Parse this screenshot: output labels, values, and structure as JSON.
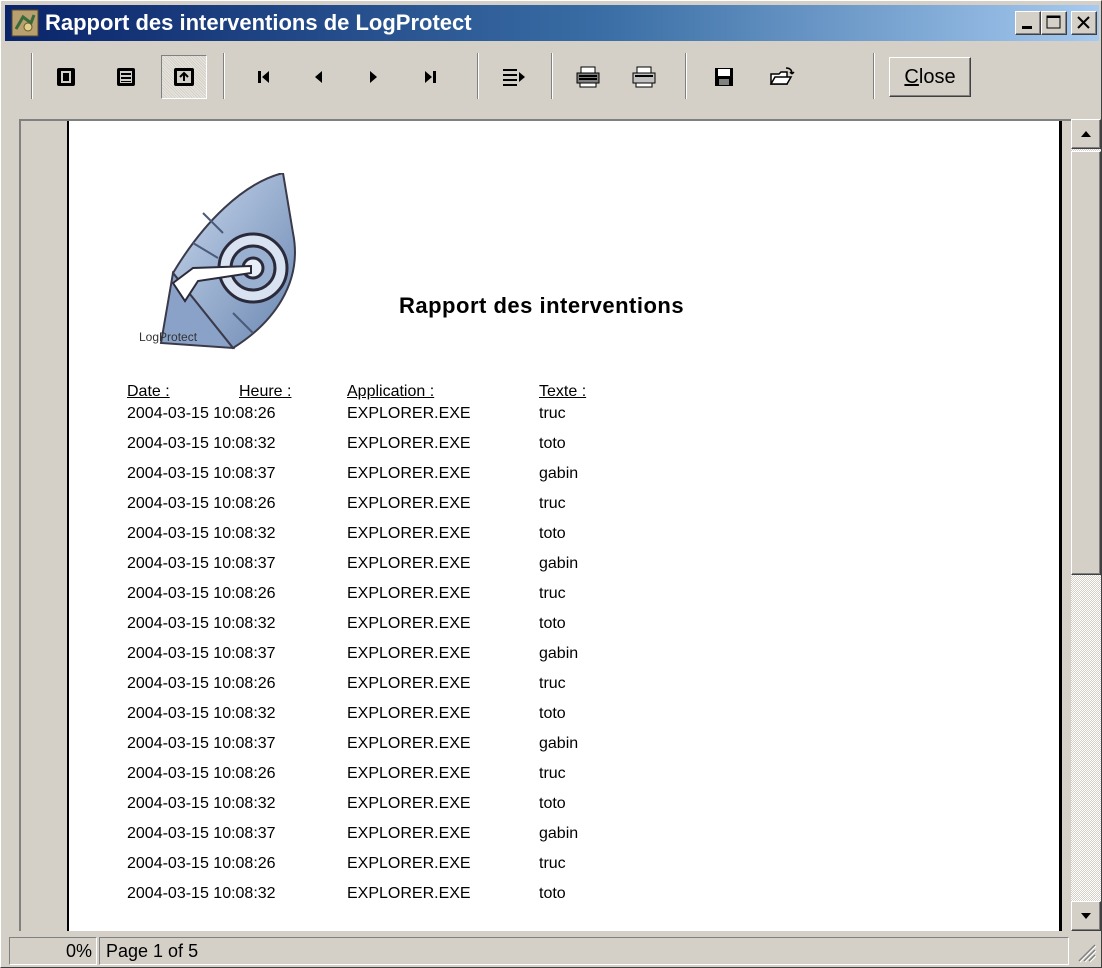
{
  "window": {
    "title": "Rapport des interventions de LogProtect"
  },
  "toolbar": {
    "close_label": "Close"
  },
  "report": {
    "logo_text": "LogProtect",
    "title": "Rapport des interventions",
    "headers": {
      "date": "Date :",
      "heure": "Heure :",
      "application": "Application :",
      "texte": "Texte :"
    },
    "rows": [
      {
        "datetime": "2004-03-15 10:08:26",
        "app": "EXPLORER.EXE",
        "text": "truc"
      },
      {
        "datetime": "2004-03-15 10:08:32",
        "app": "EXPLORER.EXE",
        "text": "toto"
      },
      {
        "datetime": "2004-03-15 10:08:37",
        "app": "EXPLORER.EXE",
        "text": "gabin"
      },
      {
        "datetime": "2004-03-15 10:08:26",
        "app": "EXPLORER.EXE",
        "text": "truc"
      },
      {
        "datetime": "2004-03-15 10:08:32",
        "app": "EXPLORER.EXE",
        "text": "toto"
      },
      {
        "datetime": "2004-03-15 10:08:37",
        "app": "EXPLORER.EXE",
        "text": "gabin"
      },
      {
        "datetime": "2004-03-15 10:08:26",
        "app": "EXPLORER.EXE",
        "text": "truc"
      },
      {
        "datetime": "2004-03-15 10:08:32",
        "app": "EXPLORER.EXE",
        "text": "toto"
      },
      {
        "datetime": "2004-03-15 10:08:37",
        "app": "EXPLORER.EXE",
        "text": "gabin"
      },
      {
        "datetime": "2004-03-15 10:08:26",
        "app": "EXPLORER.EXE",
        "text": "truc"
      },
      {
        "datetime": "2004-03-15 10:08:32",
        "app": "EXPLORER.EXE",
        "text": "toto"
      },
      {
        "datetime": "2004-03-15 10:08:37",
        "app": "EXPLORER.EXE",
        "text": "gabin"
      },
      {
        "datetime": "2004-03-15 10:08:26",
        "app": "EXPLORER.EXE",
        "text": "truc"
      },
      {
        "datetime": "2004-03-15 10:08:32",
        "app": "EXPLORER.EXE",
        "text": "toto"
      },
      {
        "datetime": "2004-03-15 10:08:37",
        "app": "EXPLORER.EXE",
        "text": "gabin"
      },
      {
        "datetime": "2004-03-15 10:08:26",
        "app": "EXPLORER.EXE",
        "text": "truc"
      },
      {
        "datetime": "2004-03-15 10:08:32",
        "app": "EXPLORER.EXE",
        "text": "toto"
      }
    ]
  },
  "status": {
    "percent": "0%",
    "page": "Page 1 of 5"
  },
  "colors": {
    "titlebar_start": "#0a246a",
    "titlebar_end": "#a6caf0",
    "face": "#d4d0c8"
  },
  "icons": [
    "app-icon",
    "minimize-icon",
    "maximize-icon",
    "close-icon",
    "one-page-icon",
    "multi-page-icon",
    "zoom-icon",
    "first-page-icon",
    "prev-page-icon",
    "next-page-icon",
    "last-page-icon",
    "export-icon",
    "print-setup-icon",
    "print-icon",
    "save-icon",
    "open-icon",
    "scroll-up-icon",
    "scroll-down-icon",
    "resize-grip-icon"
  ]
}
